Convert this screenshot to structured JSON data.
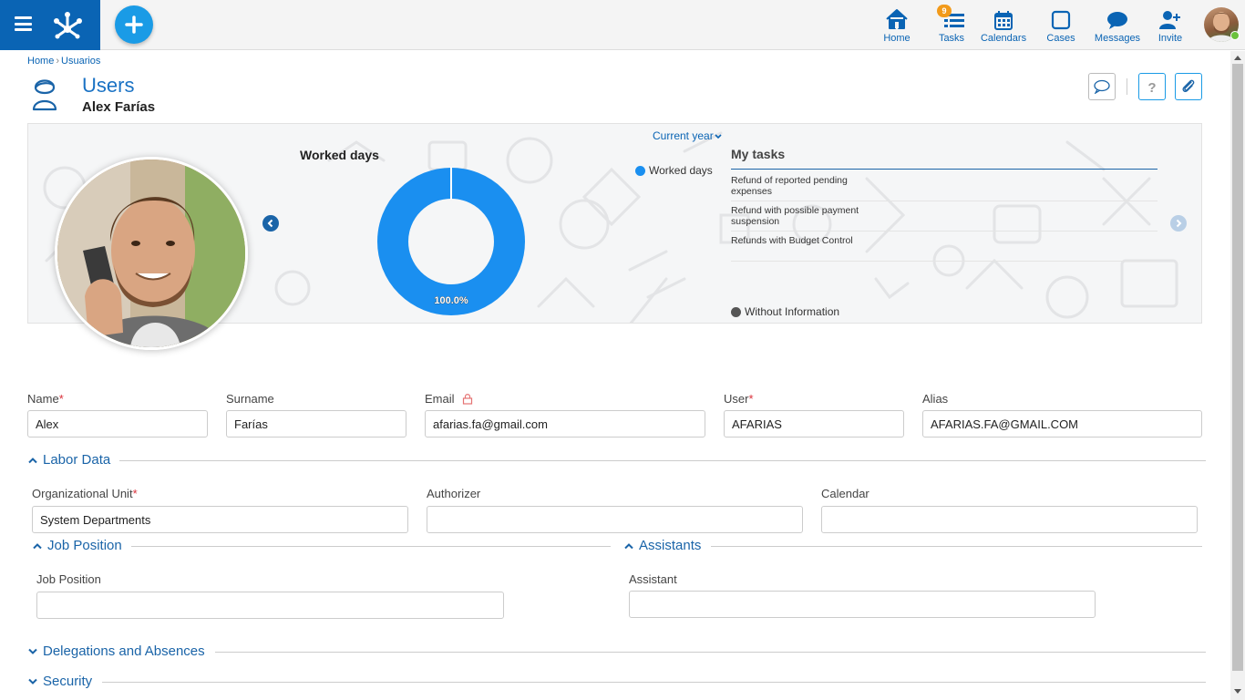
{
  "topbar": {
    "nav": [
      {
        "id": "home",
        "label": "Home",
        "icon": "home-icon"
      },
      {
        "id": "tasks",
        "label": "Tasks",
        "icon": "tasks-icon",
        "badge": "9"
      },
      {
        "id": "calendars",
        "label": "Calendars",
        "icon": "calendar-icon"
      },
      {
        "id": "cases",
        "label": "Cases",
        "icon": "cases-icon"
      },
      {
        "id": "messages",
        "label": "Messages",
        "icon": "chat-icon"
      },
      {
        "id": "invite",
        "label": "Invite",
        "icon": "invite-user-icon"
      }
    ],
    "brand_color": "#0a64b4",
    "fab_color": "#1a9be6",
    "online_color": "#6ac13b"
  },
  "breadcrumb": [
    "Home",
    "Usuarios"
  ],
  "header": {
    "title": "Users",
    "subtitle": "Alex Farías"
  },
  "banner": {
    "period": "Current year",
    "chart_title": "Worked days",
    "tasks_title": "My tasks",
    "tasks": [
      "Refund of reported pending expenses",
      "Refund with possible payment suspension",
      "Refunds with Budget Control"
    ]
  },
  "chart_data": {
    "type": "pie",
    "title": "Worked days",
    "categories": [
      "Worked days",
      "Without Information"
    ],
    "values": [
      100.0,
      0.0
    ],
    "data_labels": [
      "100.0%"
    ],
    "colors": [
      "#1a8ff0",
      "#555555"
    ],
    "legend": [
      "Worked days",
      "Without Information"
    ]
  },
  "form": {
    "name": {
      "label": "Name",
      "required": "*",
      "value": "Alex"
    },
    "surname": {
      "label": "Surname",
      "value": "Farías"
    },
    "email": {
      "label": "Email",
      "value": "afarias.fa@gmail.com"
    },
    "user": {
      "label": "User",
      "required": "*",
      "value": "AFARIAS"
    },
    "alias": {
      "label": "Alias",
      "value": "AFARIAS.FA@GMAIL.COM"
    }
  },
  "sections": {
    "labor": {
      "title": "Labor Data",
      "org_unit": {
        "label": "Organizational Unit",
        "required": "*",
        "value": "System Departments"
      },
      "authorizer": {
        "label": "Authorizer",
        "value": ""
      },
      "calendar": {
        "label": "Calendar",
        "value": ""
      }
    },
    "job": {
      "title": "Job Position",
      "job_position": {
        "label": "Job Position",
        "value": ""
      }
    },
    "assistants": {
      "title": "Assistants",
      "assistant": {
        "label": "Assistant",
        "value": ""
      }
    },
    "delegations": {
      "title": "Delegations and Absences"
    },
    "security": {
      "title": "Security"
    }
  }
}
